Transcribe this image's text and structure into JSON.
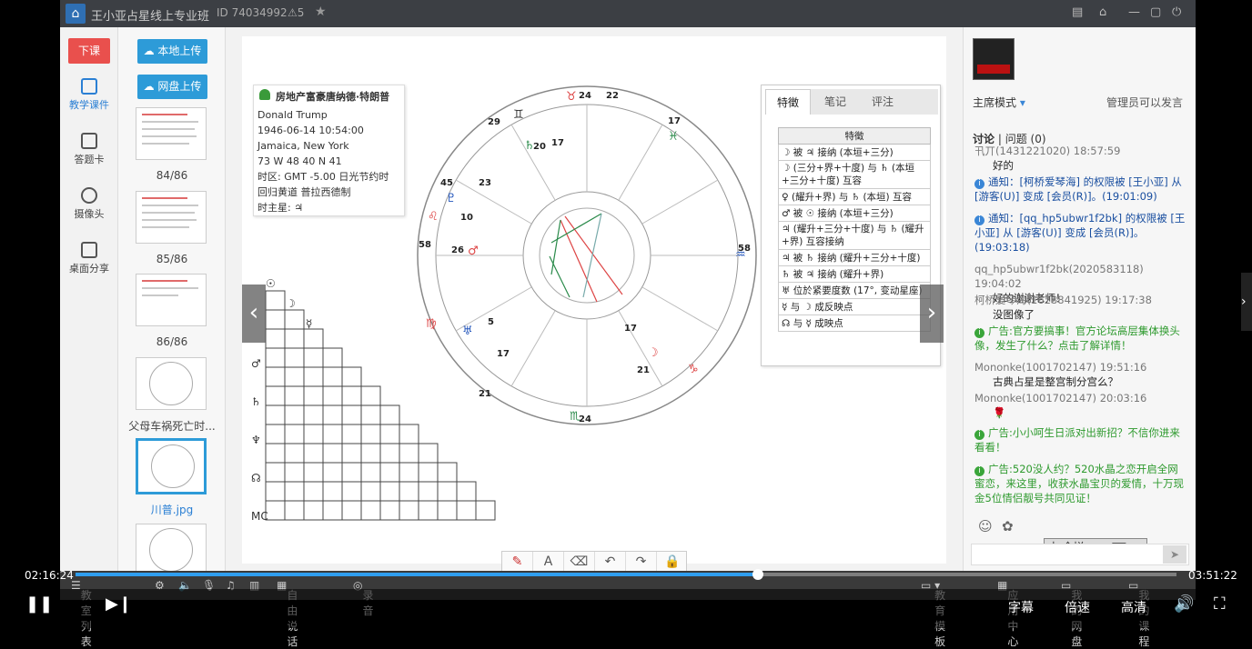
{
  "window": {
    "title": "王小亚占星线上专业班",
    "id": "ID 74034992",
    "count": "5"
  },
  "left_toolbar": {
    "end_class": "下课",
    "items": [
      "教学课件",
      "答题卡",
      "摄像头",
      "桌面分享"
    ]
  },
  "thumbs": {
    "upload_local": "本地上传",
    "upload_cloud": "网盘上传",
    "labels": [
      "84/86",
      "85/86",
      "86/86",
      "父母车祸死亡时...",
      "川普.jpg"
    ]
  },
  "profile": {
    "name_cn": "房地产富豪唐纳德·特朗普",
    "name_en": "Donald Trump",
    "datetime": "1946-06-14 10:54:00",
    "place": "Jamaica, New York",
    "coords": "73 W 48  40 N 41",
    "timezone": "时区: GMT -5.00 日光节约时",
    "house": "回归黄道 普拉西德制",
    "ruler": "时主星: ♃"
  },
  "features": {
    "tabs": [
      "特徵",
      "笔记",
      "评注"
    ],
    "header": "特徵",
    "rows": [
      "☽ 被 ♃ 接纳 (本垣+三分)",
      "☽ (三分+界+十度) 与 ♄ (本垣+三分+十度) 互容",
      "♀ (耀升+界) 与 ♄ (本垣) 互容",
      "♂ 被 ☉ 接纳 (本垣+三分)",
      "♃ (耀升+三分+十度) 与 ♄ (耀升+界) 互容接纳",
      "♃ 被 ♄ 接纳 (耀升+三分+十度)",
      "♄ 被 ♃ 接纳 (耀升+界)",
      "♅ 位於紧要度数 (17°, 变动星座)",
      "☿ 与 ☽ 成反映点",
      "☊ 与 ☿ 成映点"
    ]
  },
  "chat": {
    "mode": "主席模式",
    "admin_note": "管理员可以发言",
    "tab_discuss": "讨论",
    "tab_questions": "问题",
    "questions_count": "(0)",
    "messages": [
      {
        "who": "卂丌(1431221020) 18:57:59",
        "text": "好的"
      },
      {
        "notice": "通知：[柯桥爱琴海] 的权限被 [王小亚] 从 [游客(U)] 变成 [会员(R)]。(19:01:09)"
      },
      {
        "notice": "通知：[qq_hp5ubwr1f2bk] 的权限被 [王小亚] 从 [游客(U)] 变成 [会员(R)]。(19:03:18)"
      },
      {
        "who": "qq_hp5ubwr1f2bk(2020583118) 19:04:02",
        "text": "好的谢谢老师！"
      },
      {
        "who": "柯桥爱琴海(1628841925) 19:17:38",
        "text": "没图像了"
      },
      {
        "ad": "广告:官方要搞事！官方论坛高层集体换头像，发生了什么？点击了解详情！"
      },
      {
        "who": "Mononke(1001702147) 19:51:16",
        "text": "古典占星是整宫制分宫么？"
      },
      {
        "who": "Mononke(1001702147) 20:03:16",
        "text": "🌹"
      },
      {
        "ad": "广告:小小呵生日派对出新招？不信你进来看看！"
      },
      {
        "ad": "广告:520没人约？520水晶之恋开启全网蜜恋，来这里，收获水晶宝贝的爱情，十万现金5位情侣靓号共同见证！"
      }
    ],
    "ime_label": "全拼"
  },
  "app_bottom": {
    "items": [
      "教室列表",
      "自由说话",
      "录音",
      "教育模板",
      "应用中心",
      "我的网盘",
      "我的课程"
    ]
  },
  "player": {
    "current_time": "02:16:24",
    "total_time": "03:51:22",
    "progress": 0.62,
    "subtitle": "字幕",
    "speed": "倍速",
    "quality": "高清"
  }
}
